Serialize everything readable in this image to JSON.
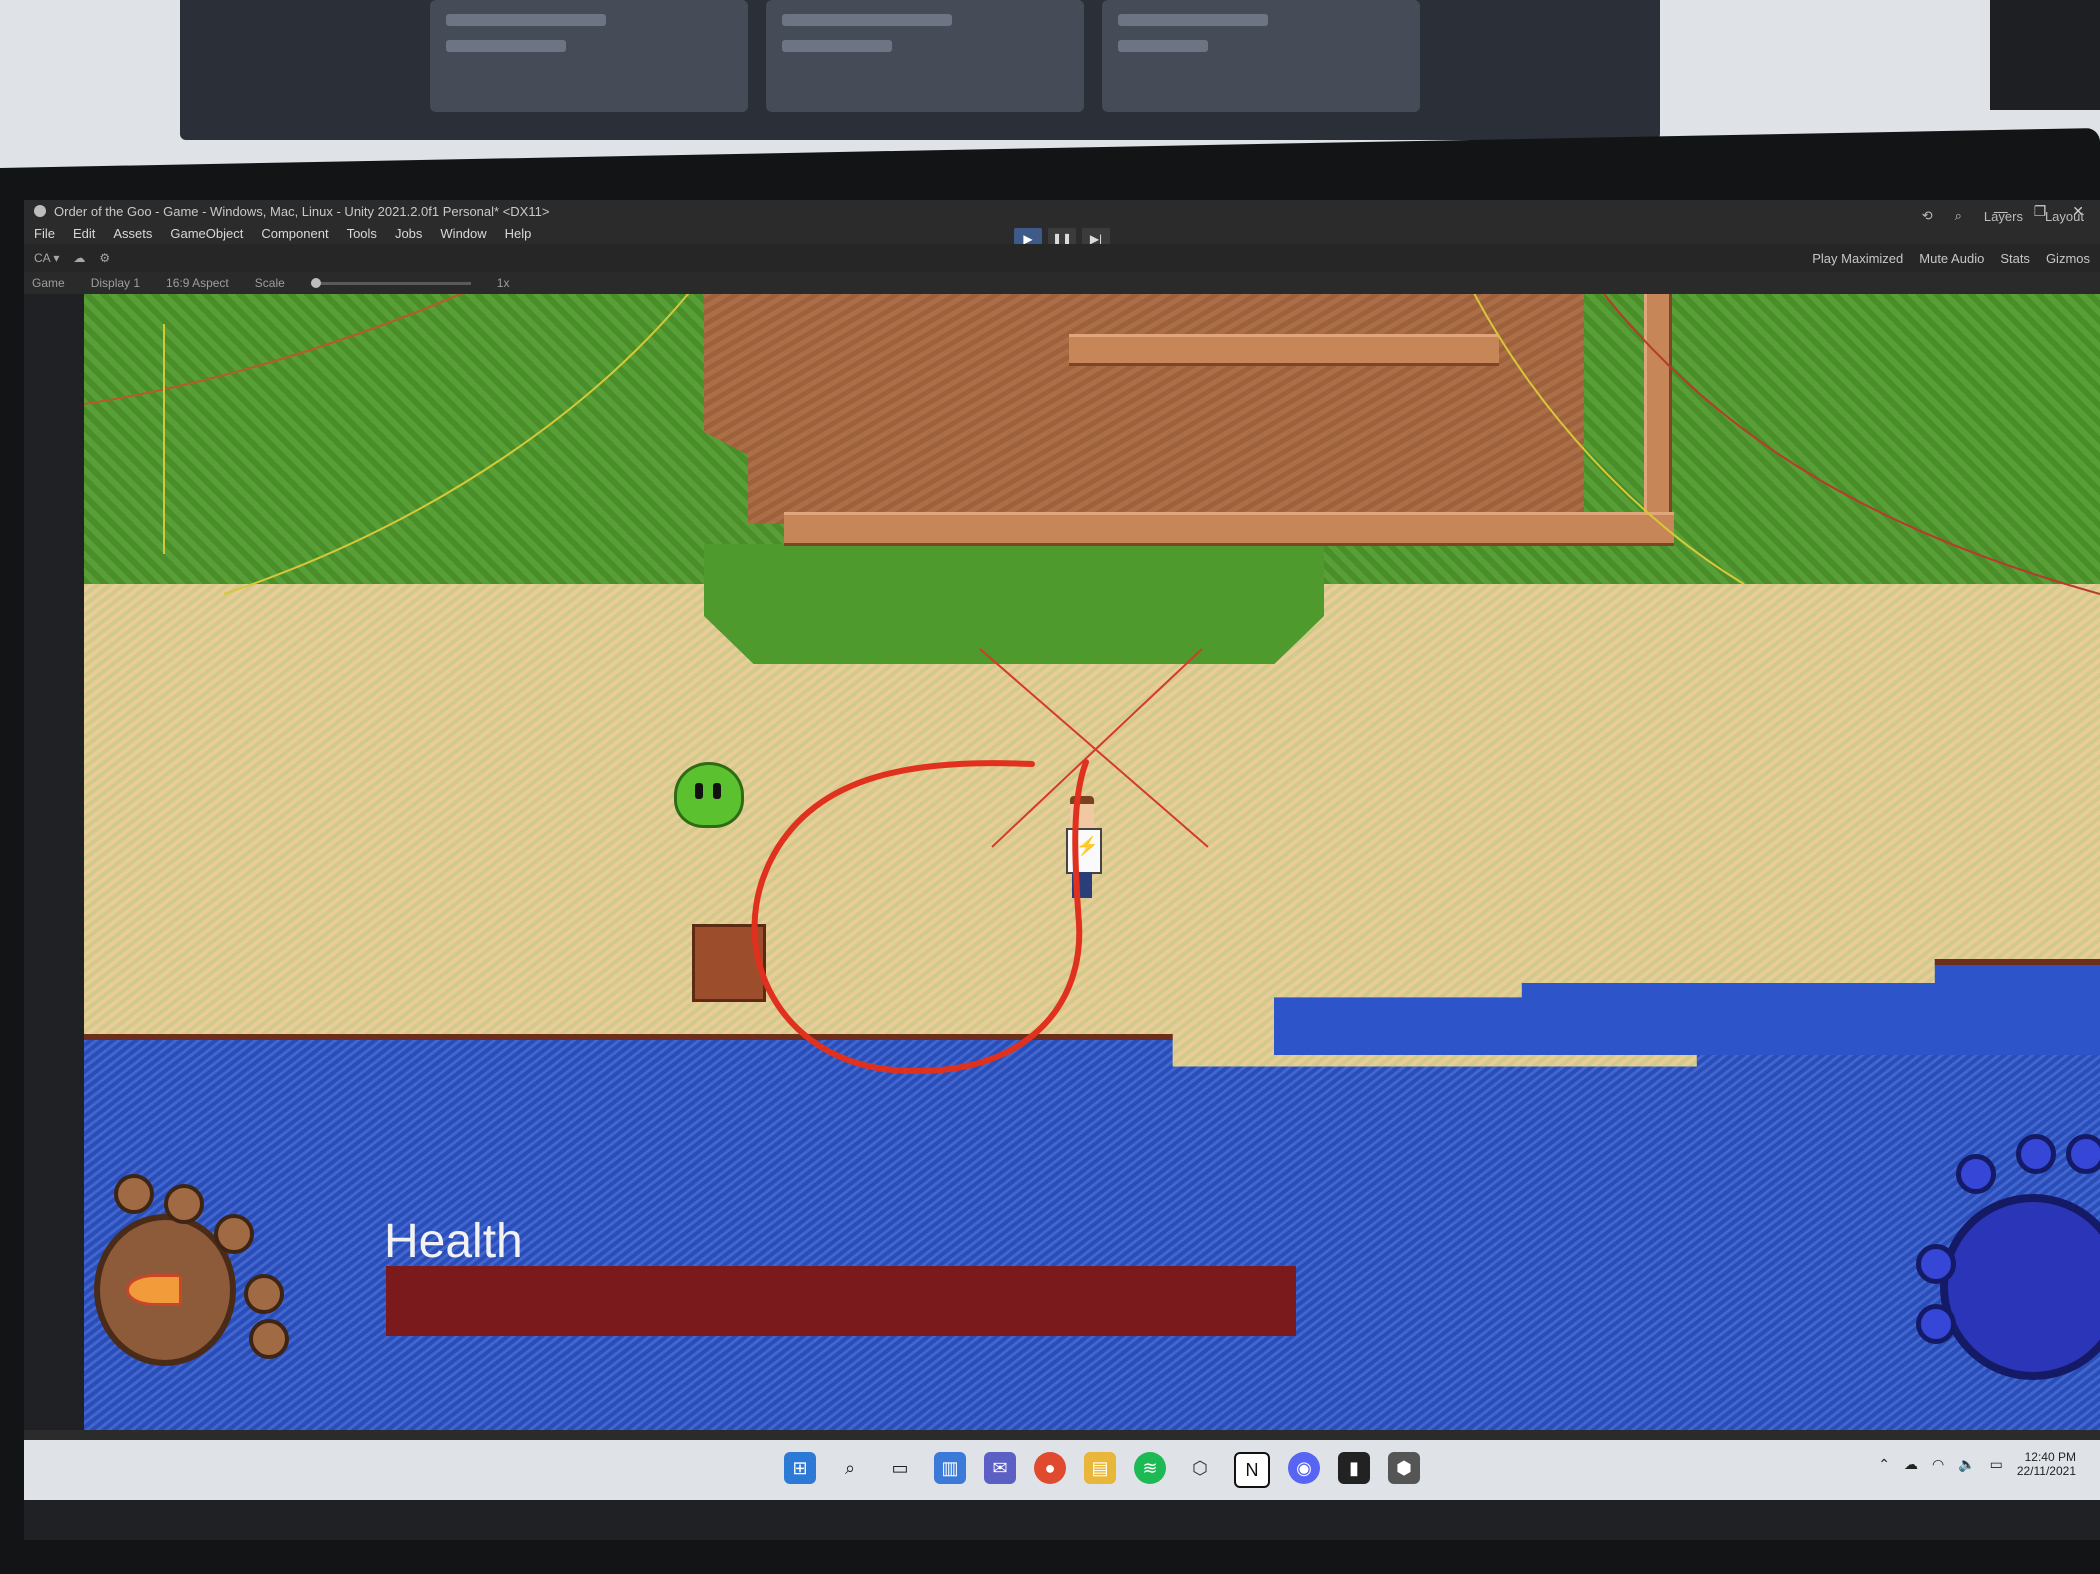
{
  "window": {
    "title": "Order of the Goo - Game - Windows, Mac, Linux - Unity 2021.2.0f1 Personal* <DX11>",
    "controls": [
      "—",
      "❐",
      "✕"
    ]
  },
  "menu": [
    "File",
    "Edit",
    "Assets",
    "GameObject",
    "Component",
    "Tools",
    "Jobs",
    "Window",
    "Help"
  ],
  "toolbar": {
    "account": "CA ▾",
    "layers": "Layers",
    "layout": "Layout"
  },
  "game_tab": {
    "tab_label": "Game",
    "view_select": "Game",
    "display": "Display 1",
    "aspect": "16:9 Aspect",
    "scale_label": "Scale",
    "scale_value": "1x",
    "play_maximized": "Play Maximized",
    "mute_audio": "Mute Audio",
    "stats": "Stats",
    "gizmos": "Gizmos"
  },
  "hud": {
    "health_label": "Health",
    "health_fraction": 1.0,
    "health_color": "#7b1a1c"
  },
  "colors": {
    "grass": "#4f9a2c",
    "sand": "#e5cf95",
    "water": "#2d55c9",
    "annotation_red": "#e0311f"
  },
  "taskbar": {
    "icons": [
      "windows-start-icon",
      "search-icon",
      "task-view-icon",
      "widgets-icon",
      "chat-icon",
      "chrome-icon",
      "file-explorer-icon",
      "spotify-icon",
      "unity-hub-icon",
      "notion-icon",
      "discord-icon",
      "app-icon",
      "unity-icon"
    ],
    "time": "12:40 PM",
    "date": "22/11/2021"
  }
}
